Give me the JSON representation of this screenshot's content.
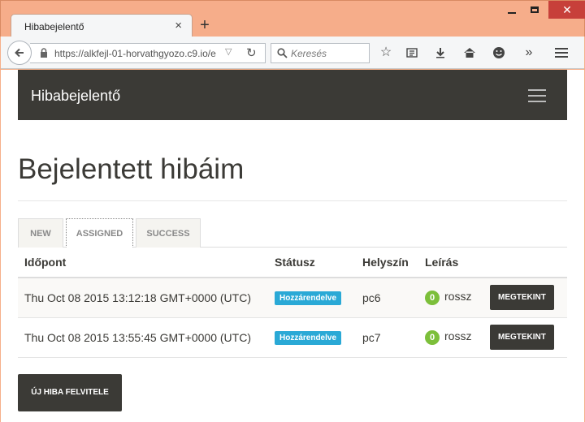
{
  "browser": {
    "tab_title": "Hibabejelentő",
    "tab_close": "×",
    "new_tab": "+",
    "url": "https://alkfejl-01-horvathgyozo.c9.io/e",
    "search_placeholder": "Keresés",
    "window_close": "✕"
  },
  "app": {
    "brand": "Hibabejelentő",
    "title": "Bejelentett hibáim",
    "tabs": [
      {
        "label": "NEW",
        "active": false
      },
      {
        "label": "ASSIGNED",
        "active": true
      },
      {
        "label": "SUCCESS",
        "active": false
      }
    ],
    "table": {
      "headers": [
        "Időpont",
        "Státusz",
        "Helyszín",
        "Leírás"
      ],
      "rows": [
        {
          "time": "Thu Oct 08 2015 13:12:18 GMT+0000 (UTC)",
          "status": "Hozzárendelve",
          "location": "pc6",
          "count": "0",
          "description": "rossz",
          "action": "MEGTEKINT"
        },
        {
          "time": "Thu Oct 08 2015 13:55:45 GMT+0000 (UTC)",
          "status": "Hozzárendelve",
          "location": "pc7",
          "count": "0",
          "description": "rossz",
          "action": "MEGTEKINT"
        }
      ]
    },
    "new_button": "ÚJ HIBA FELVITELE"
  },
  "colors": {
    "primary_dark": "#3b3a36",
    "status_badge": "#2aa9d6",
    "count_badge": "#7cbf3a",
    "window_frame": "#f6ad8a"
  }
}
